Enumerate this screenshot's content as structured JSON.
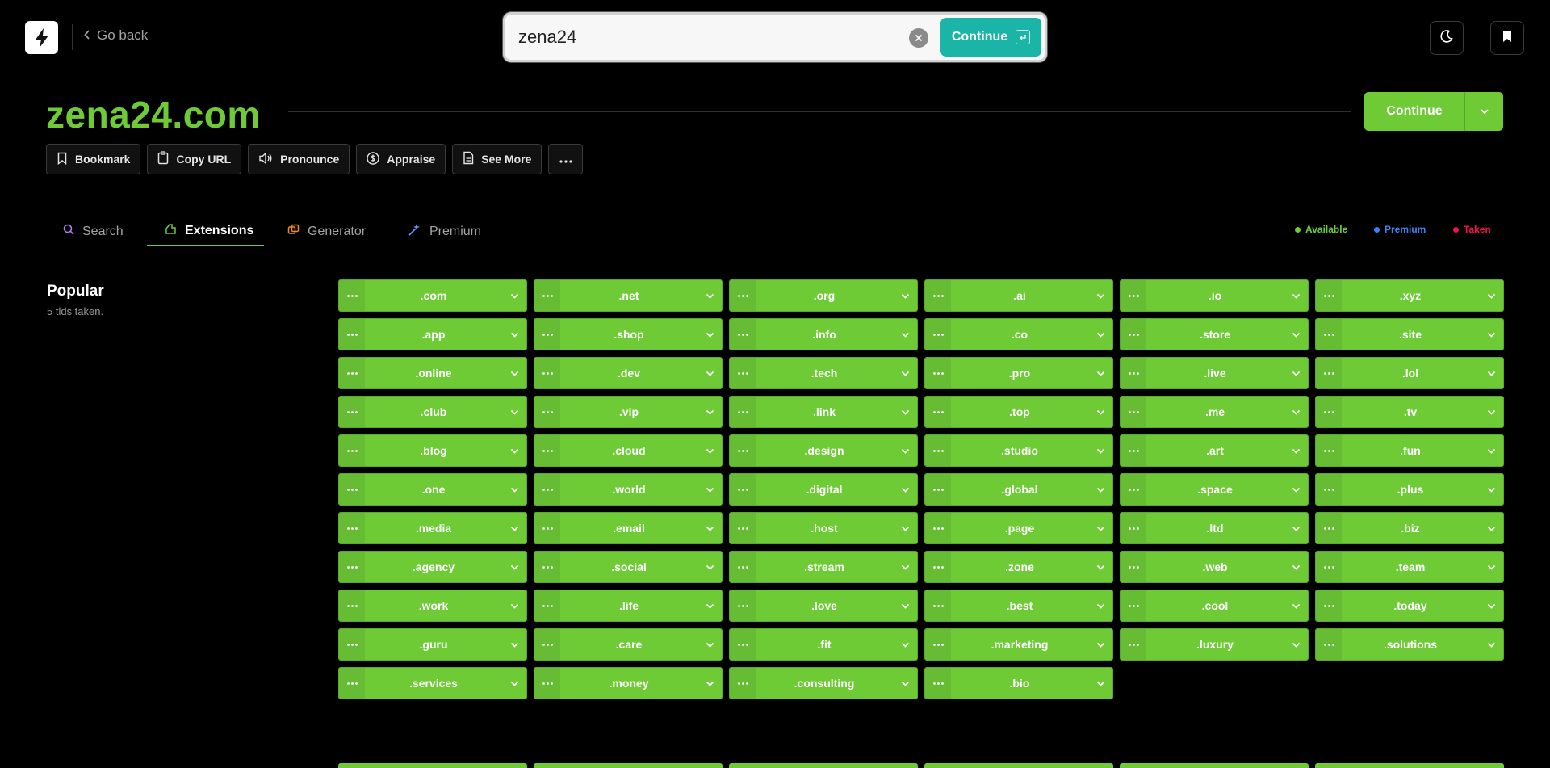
{
  "nav": {
    "logo_icon": "bolt-icon",
    "go_back": "Go back"
  },
  "search": {
    "value": "zena24",
    "continue_label": "Continue"
  },
  "domain": {
    "name": "zena24.com",
    "continue_label": "Continue"
  },
  "actions": [
    {
      "label": "Bookmark",
      "icon": "bookmark-icon"
    },
    {
      "label": "Copy URL",
      "icon": "clipboard-icon"
    },
    {
      "label": "Pronounce",
      "icon": "speaker-icon"
    },
    {
      "label": "Appraise",
      "icon": "dollar-icon"
    },
    {
      "label": "See More",
      "icon": "document-icon"
    }
  ],
  "tabs": [
    {
      "label": "Search",
      "icon": "search-icon"
    },
    {
      "label": "Extensions",
      "icon": "extensions-icon",
      "active": true
    },
    {
      "label": "Generator",
      "icon": "generator-icon"
    },
    {
      "label": "Premium",
      "icon": "sparkle-icon"
    }
  ],
  "legend": [
    {
      "label": "Available",
      "color": "#6ecb36"
    },
    {
      "label": "Premium",
      "color": "#3b82f6"
    },
    {
      "label": "Taken",
      "color": "#f0134d"
    }
  ],
  "popular": {
    "title": "Popular",
    "subtitle": "5 tlds taken.",
    "tlds": [
      ".com",
      ".net",
      ".org",
      ".ai",
      ".io",
      ".xyz",
      ".app",
      ".shop",
      ".info",
      ".co",
      ".store",
      ".site",
      ".online",
      ".dev",
      ".tech",
      ".pro",
      ".live",
      ".lol",
      ".club",
      ".vip",
      ".link",
      ".top",
      ".me",
      ".tv",
      ".blog",
      ".cloud",
      ".design",
      ".studio",
      ".art",
      ".fun",
      ".one",
      ".world",
      ".digital",
      ".global",
      ".space",
      ".plus",
      ".media",
      ".email",
      ".host",
      ".page",
      ".ltd",
      ".biz",
      ".agency",
      ".social",
      ".stream",
      ".zone",
      ".web",
      ".team",
      ".work",
      ".life",
      ".love",
      ".best",
      ".cool",
      ".today",
      ".guru",
      ".care",
      ".fit",
      ".marketing",
      ".luxury",
      ".solutions",
      ".services",
      ".money",
      ".consulting",
      ".bio"
    ]
  },
  "colors": {
    "accent": "#6ecb36",
    "teal": "#1ab5a6",
    "background": "#000000"
  }
}
